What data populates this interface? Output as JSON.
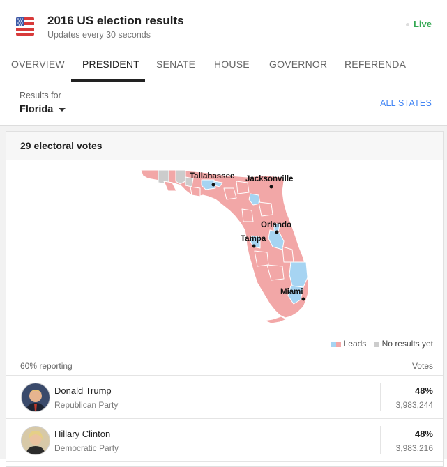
{
  "header": {
    "title": "2016 US election results",
    "subtitle": "Updates every 30 seconds",
    "live": "Live"
  },
  "tabs": [
    {
      "label": "OVERVIEW"
    },
    {
      "label": "PRESIDENT",
      "active": true
    },
    {
      "label": "SENATE"
    },
    {
      "label": "HOUSE"
    },
    {
      "label": "GOVERNOR"
    },
    {
      "label": "REFERENDA"
    }
  ],
  "filter": {
    "results_for": "Results for",
    "state": "Florida",
    "all_states": "ALL STATES"
  },
  "card": {
    "electoral_votes": "29 electoral votes",
    "map": {
      "cities": [
        "Tallahassee",
        "Jacksonville",
        "Orlando",
        "Tampa",
        "Miami"
      ],
      "colors": {
        "republican_lead": "#f2a7a7",
        "democratic_lead": "#a6d4f2",
        "no_results": "#cccccc"
      }
    },
    "legend": {
      "leads": "Leads",
      "no_results": "No results yet"
    }
  },
  "results": {
    "reporting": "60% reporting",
    "votes_header": "Votes",
    "candidates": [
      {
        "name": "Donald Trump",
        "party": "Republican Party",
        "percent": "48%",
        "votes": "3,983,244"
      },
      {
        "name": "Hillary Clinton",
        "party": "Democratic Party",
        "percent": "48%",
        "votes": "3,983,216"
      }
    ]
  }
}
